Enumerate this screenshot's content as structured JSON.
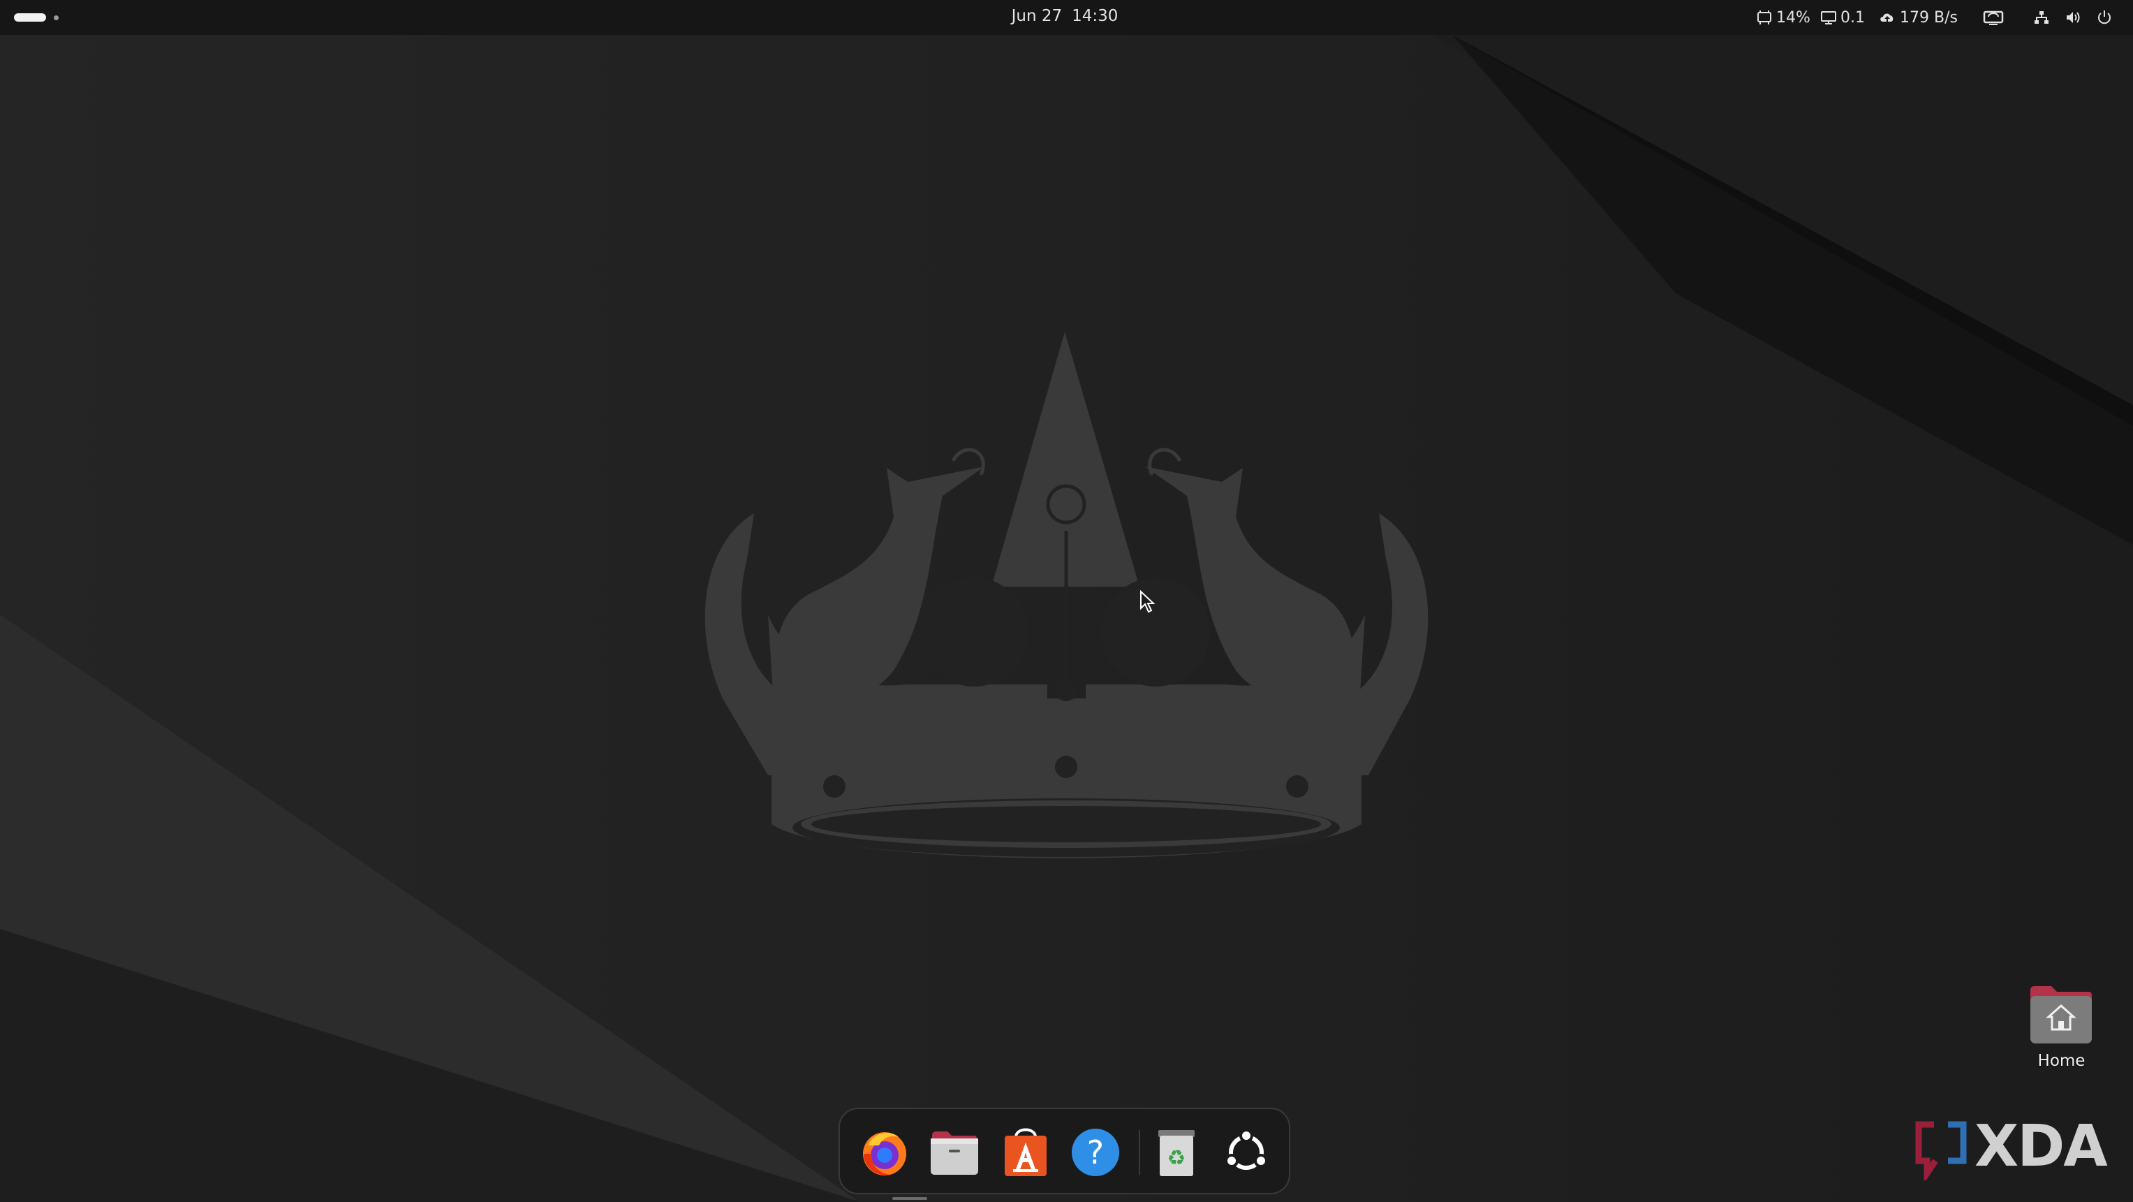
{
  "topbar": {
    "activities_icon": "activities-indicator",
    "clock": {
      "date": "Jun 27",
      "time": "14:30"
    },
    "tray": {
      "cpu": {
        "icon": "cpu-icon",
        "value": "14%"
      },
      "load": {
        "icon": "monitor-icon",
        "value": "0.1"
      },
      "network_speed": {
        "icon": "cloud-upload-icon",
        "value": "179 B/s"
      },
      "screen_share_icon": "screen-share-icon",
      "network_icon": "network-icon",
      "volume_icon": "speaker-icon",
      "power_icon": "power-icon"
    }
  },
  "desktop": {
    "home_folder": {
      "label": "Home",
      "icon": "home-folder-icon"
    }
  },
  "dock": {
    "items": [
      {
        "name": "Firefox",
        "icon": "firefox-icon"
      },
      {
        "name": "Files",
        "icon": "files-icon"
      },
      {
        "name": "App Center",
        "icon": "app-center-icon"
      },
      {
        "name": "Help",
        "icon": "help-icon"
      },
      {
        "name": "Trash",
        "icon": "trash-icon"
      },
      {
        "name": "Show Apps",
        "icon": "ubuntu-logo-icon"
      }
    ]
  },
  "watermark": {
    "text": "XDA"
  },
  "colors": {
    "background": "#222222",
    "topbar": "#161616",
    "crown": "#3a3a3a",
    "ubuntu_orange": "#e95420"
  }
}
